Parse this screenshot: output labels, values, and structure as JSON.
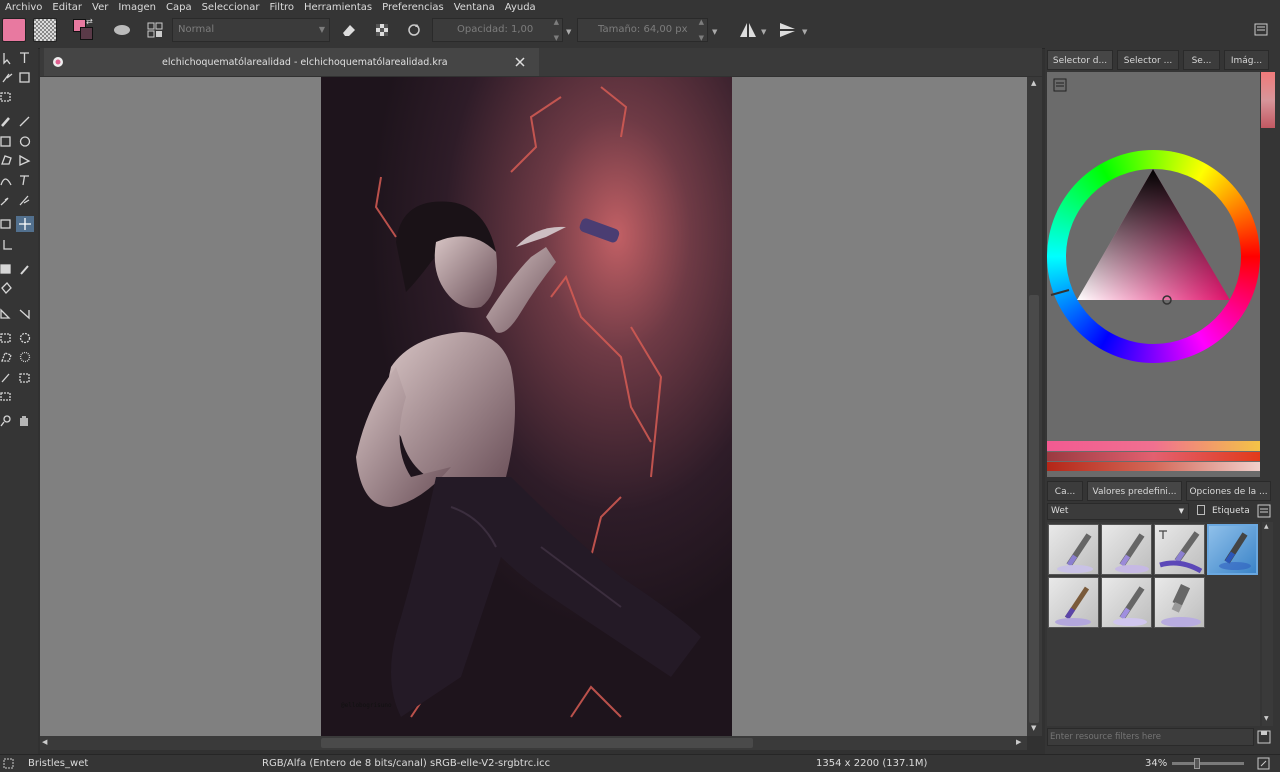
{
  "menu": [
    "Archivo",
    "Editar",
    "Ver",
    "Imagen",
    "Capa",
    "Seleccionar",
    "Filtro",
    "Herramientas",
    "Preferencias",
    "Ventana",
    "Ayuda"
  ],
  "toolbar": {
    "blend_mode": "Normal",
    "opacity_label": "Opacidad:",
    "opacity_value": "1,00",
    "size_label": "Tamaño:",
    "size_value": "64,00 px"
  },
  "colors": {
    "foreground": "#e879a0",
    "background": "#2b1d24",
    "accent": "#5a8fc0"
  },
  "document": {
    "tab_title": "elchichoquematólarealidad - elchichoquematólarealidad.kra",
    "signature": "@ellobogrisuno"
  },
  "docker": {
    "top_tabs": [
      "Selector d...",
      "Selector ...",
      "Se...",
      "Imág..."
    ],
    "preset_tabs": [
      "Ca...",
      "Valores predefini...",
      "Opciones de la ..."
    ],
    "preset_filter": "Wet",
    "tag_label": "Etiqueta",
    "resource_filter_placeholder": "Enter resource filters here"
  },
  "status": {
    "brush": "Bristles_wet",
    "color_space": "RGB/Alfa (Entero de 8 bits/canal)  sRGB-elle-V2-srgbtrc.icc",
    "dimensions": "1354 x 2200 (137.1M)",
    "zoom": "34%"
  }
}
